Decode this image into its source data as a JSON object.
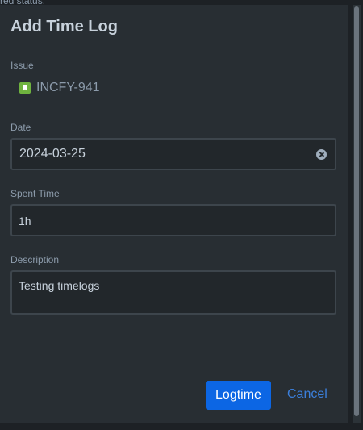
{
  "background": {
    "text": "red status:"
  },
  "dialog": {
    "title": "Add Time Log",
    "issue": {
      "label": "Issue",
      "key": "INCFY-941",
      "icon": "story-bookmark-icon",
      "icon_color": "#6fb33f"
    },
    "date": {
      "label": "Date",
      "value": "2024-03-25",
      "clear_icon": "clear-circle-x-icon"
    },
    "spent_time": {
      "label": "Spent Time",
      "value": "1h"
    },
    "description": {
      "label": "Description",
      "value": "Testing timelogs"
    },
    "buttons": {
      "primary": "Logtime",
      "cancel": "Cancel"
    }
  },
  "colors": {
    "dialog_bg": "#282e33",
    "input_bg": "#22272b",
    "primary_button": "#0c66e4",
    "link": "#3b7fdb",
    "text": "#c7d1db",
    "muted": "#8c9bab"
  }
}
